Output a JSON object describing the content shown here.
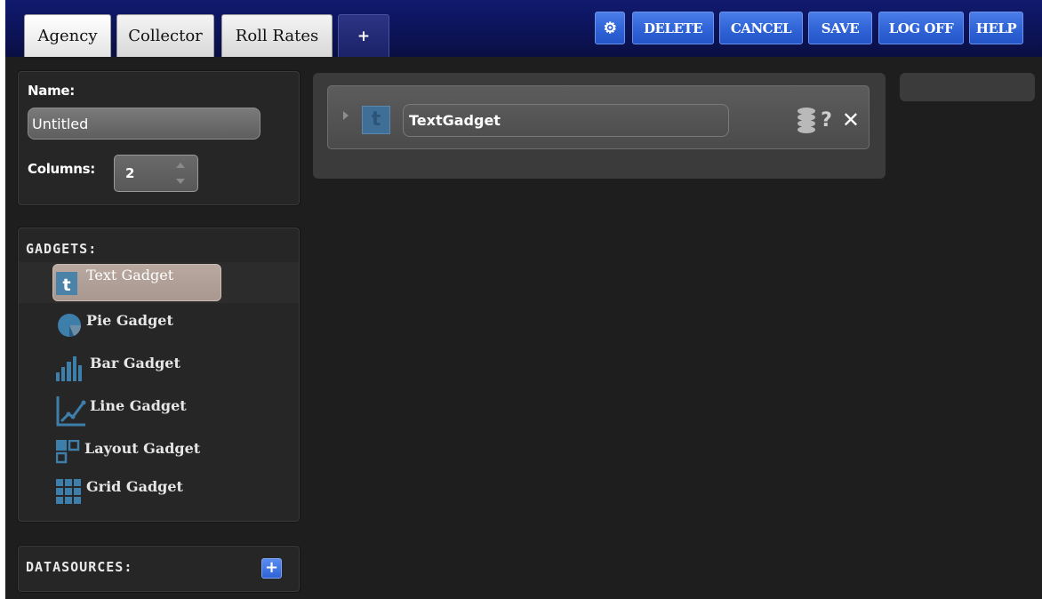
{
  "tabs": [
    {
      "label": "Agency"
    },
    {
      "label": "Collector"
    },
    {
      "label": "Roll Rates"
    },
    {
      "label": "+"
    }
  ],
  "toolbar": {
    "settings_label": "⚙",
    "delete_label": "DELETE",
    "cancel_label": "CANCEL",
    "save_label": "SAVE",
    "logoff_label": "LOG OFF",
    "help_label": "HELP"
  },
  "properties": {
    "name_label": "Name:",
    "name_value": "Untitled",
    "columns_label": "Columns:",
    "columns_value": "2"
  },
  "gadgets": {
    "title": "GADGETS:",
    "items": [
      {
        "label": "Text Gadget",
        "icon": "text-icon"
      },
      {
        "label": "Pie Gadget",
        "icon": "pie-chart-icon"
      },
      {
        "label": "Bar Gadget",
        "icon": "bar-chart-icon"
      },
      {
        "label": "Line Gadget",
        "icon": "line-chart-icon"
      },
      {
        "label": "Layout Gadget",
        "icon": "layout-icon"
      },
      {
        "label": "Grid Gadget",
        "icon": "grid-icon"
      }
    ]
  },
  "datasources": {
    "title": "DATASOURCES:",
    "add_label": "+"
  },
  "dashboard": {
    "gadget": {
      "icon_letter": "t",
      "title": "TextGadget",
      "help_label": "?",
      "close_label": "✕"
    }
  },
  "colors": {
    "accent": "#2f63d6",
    "gadget_icon": "#3f6f96",
    "background": "#1e1e1e"
  }
}
